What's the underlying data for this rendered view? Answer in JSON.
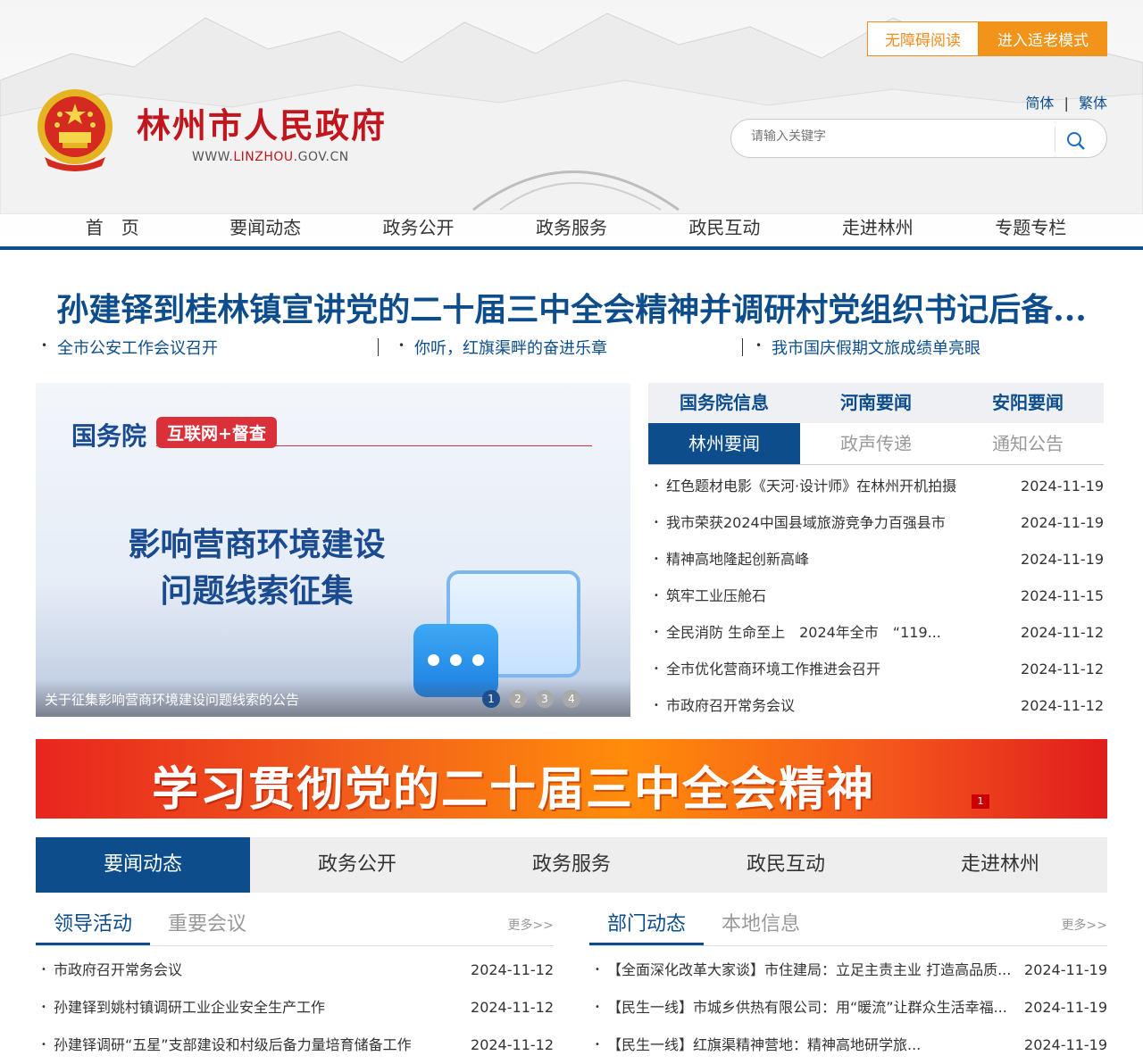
{
  "header": {
    "btn_accessibility": "无障碍阅读",
    "btn_elder": "进入适老模式",
    "site_name": "林州市人民政府",
    "url_prefix": "WWW.",
    "url_domain": "LINZHOU",
    "url_suffix": ".GOV.CN",
    "lang_simplified": "简体",
    "lang_sep": "|",
    "lang_traditional": "繁体",
    "search_placeholder": "请输入关键字",
    "nav": [
      "首　页",
      "要闻动态",
      "政务公开",
      "政务服务",
      "政民互动",
      "走进林州",
      "专题专栏"
    ]
  },
  "headline": {
    "title": "孙建铎到桂林镇宣讲党的二十届三中全会精神并调研村党组织书记后备...",
    "sub": [
      "全市公安工作会议召开",
      "你听，红旗渠畔的奋进乐章",
      "我市国庆假期文旅成绩单亮眼"
    ]
  },
  "carousel": {
    "gov_label": "国务院",
    "tag_label": "互联网+督查",
    "title_line1": "影响营商环境建设",
    "title_line2": "问题线索征集",
    "caption": "关于征集影响营商环境建设问题线索的公告",
    "dots": [
      "1",
      "2",
      "3",
      "4"
    ],
    "active_dot": "1"
  },
  "news_panel": {
    "tabs_top": [
      "国务院信息",
      "河南要闻",
      "安阳要闻"
    ],
    "tabs_bottom": [
      "林州要闻",
      "政声传递",
      "通知公告"
    ],
    "active_tab": "林州要闻",
    "items": [
      {
        "title": "红色题材电影《天河·设计师》在林州开机拍摄",
        "date": "2024-11-19"
      },
      {
        "title": "我市荣获2024中国县域旅游竞争力百强县市",
        "date": "2024-11-19"
      },
      {
        "title": "精神高地隆起创新高峰",
        "date": "2024-11-19"
      },
      {
        "title": "筑牢工业压舱石",
        "date": "2024-11-15"
      },
      {
        "title": "全民消防 生命至上　2024年全市　“119...",
        "date": "2024-11-12"
      },
      {
        "title": " 全市优化营商环境工作推进会召开",
        "date": "2024-11-12"
      },
      {
        "title": "市政府召开常务会议",
        "date": "2024-11-12"
      }
    ]
  },
  "banner": {
    "text": "学习贯彻党的二十届三中全会精神",
    "dot": "1"
  },
  "big_tabs": {
    "items": [
      "要闻动态",
      "政务公开",
      "政务服务",
      "政民互动",
      "走进林州"
    ],
    "active": "要闻动态"
  },
  "left_column": {
    "tabs": [
      "领导活动",
      "重要会议"
    ],
    "active": "领导活动",
    "more": "更多>>",
    "items": [
      {
        "title": "市政府召开常务会议",
        "date": "2024-11-12"
      },
      {
        "title": "孙建铎到姚村镇调研工业企业安全生产工作",
        "date": "2024-11-12"
      },
      {
        "title": "孙建铎调研“五星”支部建设和村级后备力量培育储备工作",
        "date": "2024-11-12"
      }
    ]
  },
  "right_column": {
    "tabs": [
      "部门动态",
      "本地信息"
    ],
    "active": "部门动态",
    "more": "更多>>",
    "items": [
      {
        "title": "【全面深化改革大家谈】市住建局：立足主责主业 打造高品质...",
        "date": "2024-11-19"
      },
      {
        "title": "【民生一线】市城乡供热有限公司：用“暖流”让群众生活幸福...",
        "date": "2024-11-19"
      },
      {
        "title": "【民生一线】红旗渠精神营地：精神高地研学旅...",
        "date": "2024-11-19"
      }
    ]
  },
  "colors": {
    "primary": "#0d4d8c",
    "brand_red": "#c1161e",
    "orange": "#f29419"
  }
}
